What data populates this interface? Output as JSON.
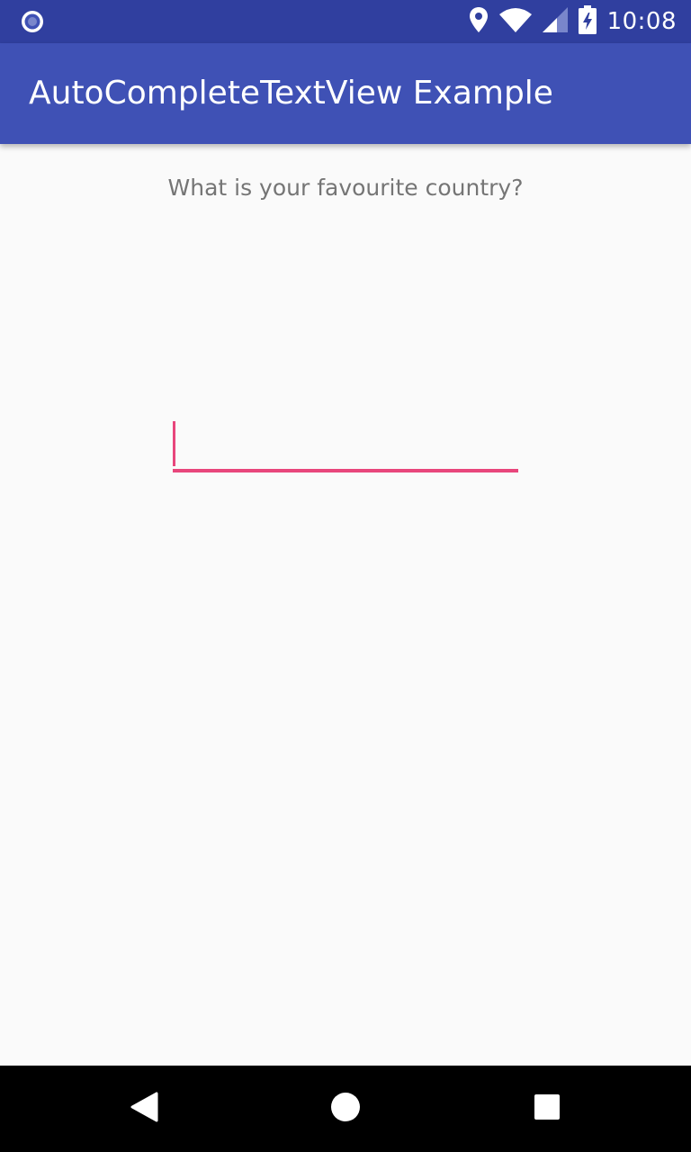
{
  "status_bar": {
    "time": "10:08",
    "icons": [
      "notification-record-icon",
      "location-icon",
      "wifi-icon",
      "signal-icon",
      "battery-charging-icon"
    ]
  },
  "app_bar": {
    "title": "AutoCompleteTextView Example"
  },
  "content": {
    "question": "What is your favourite country?",
    "country_input": {
      "value": "",
      "placeholder": ""
    }
  },
  "nav_bar": {
    "icons": [
      "back-icon",
      "home-icon",
      "recents-icon"
    ]
  },
  "colors": {
    "status_bar": "#303f9f",
    "app_bar": "#3f51b5",
    "accent": "#e8467c",
    "background": "#fafafa",
    "question_text": "#757575"
  }
}
